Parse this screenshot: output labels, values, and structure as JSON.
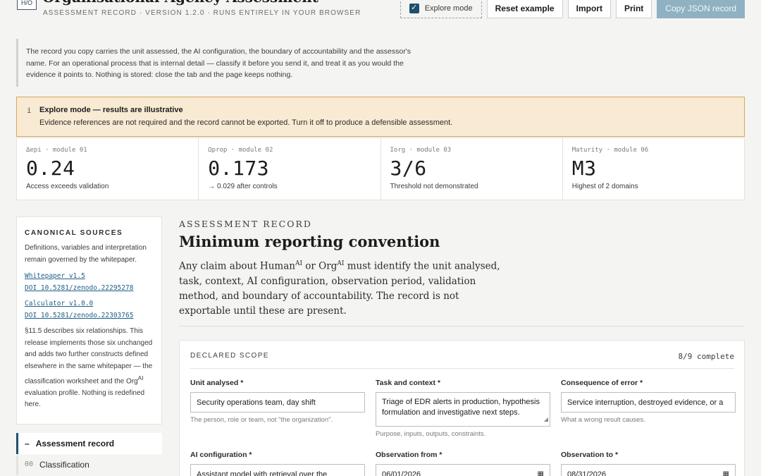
{
  "header": {
    "logo_text": "H/O",
    "title": "Organisational Agency Assessment",
    "subtitle": "ASSESSMENT RECORD · VERSION 1.2.0 · RUNS ENTIRELY IN YOUR BROWSER",
    "explore_toggle_label": "Explore mode",
    "explore_toggle_checked": true,
    "buttons": {
      "reset": "Reset example",
      "import": "Import",
      "print": "Print",
      "copy": "Copy JSON record"
    }
  },
  "notice": "The record you copy carries the unit assessed, the AI configuration, the boundary of accountability and the assessor's name. For an operational process that is internal detail — classify it before you send it, and treat it as you would the evidence it points to. Nothing is stored: close the tab and the page keeps nothing.",
  "banner": {
    "icon": "i",
    "title": "Explore mode — results are illustrative",
    "text": "Evidence references are not required and the record cannot be exported. Turn it off to produce a defensible assessment."
  },
  "metrics": [
    {
      "label": "Δepi · module 01",
      "value": "0.24",
      "note": "Access exceeds validation"
    },
    {
      "label": "Ωprop · module 02",
      "value": "0.173",
      "note": "→ 0.029 after controls"
    },
    {
      "label": "Iorg · module 03",
      "value": "3/6",
      "note": "Threshold not demonstrated"
    },
    {
      "label": "Maturity · module 06",
      "value": "M3",
      "note": "Highest of 2 domains"
    }
  ],
  "sidebar": {
    "heading": "CANONICAL SOURCES",
    "intro": "Definitions, variables and interpretation remain governed by the whitepaper.",
    "links": [
      {
        "title": "Whitepaper v1.5",
        "doi": "DOI 10.5281/zenodo.22295278"
      },
      {
        "title": "Calculator v1.0.0",
        "doi": "DOI 10.5281/zenodo.22303765"
      }
    ],
    "body_pre": "§11.5 describes six relationships. This release implements those six unchanged and adds two further constructs defined elsewhere in the same whitepaper — the classification worksheet and the Org",
    "body_sup": "AI",
    "body_post": " evaluation profile. Nothing is redefined here.",
    "nav": [
      {
        "marker": "–",
        "label": "Assessment record",
        "active": true
      },
      {
        "marker": "00",
        "label": "Classification",
        "active": false
      }
    ]
  },
  "main": {
    "eyebrow": "ASSESSMENT RECORD",
    "heading": "Minimum reporting convention",
    "lede": {
      "p1": "Any claim about Human",
      "sup1": "AI",
      "p2": " or Org",
      "sup2": "AI",
      "p3": " must identify the unit analysed, task, context, AI configuration, observation period, validation method, and boundary of accountability. The record is not exportable until these are present."
    },
    "scope": {
      "heading": "DECLARED SCOPE",
      "count": "8/9 complete",
      "fields": {
        "unit": {
          "label": "Unit analysed *",
          "value": "Security operations team, day shift",
          "hint": "The person, role or team, not \"the organization\"."
        },
        "task": {
          "label": "Task and context *",
          "value": "Triage of EDR alerts in production, hypothesis formulation and investigative next steps.",
          "hint": "Purpose, inputs, outputs, constraints."
        },
        "consequence": {
          "label": "Consequence of error *",
          "value": "Service interruption, destroyed evidence, or a",
          "hint": "What a wrong result causes."
        },
        "ai_config": {
          "label": "AI configuration *",
          "value": "Assistant model with retrieval over the"
        },
        "obs_from": {
          "label": "Observation from *",
          "value": "06/01/2026"
        },
        "obs_to": {
          "label": "Observation to *",
          "value": "08/31/2026"
        }
      }
    }
  }
}
